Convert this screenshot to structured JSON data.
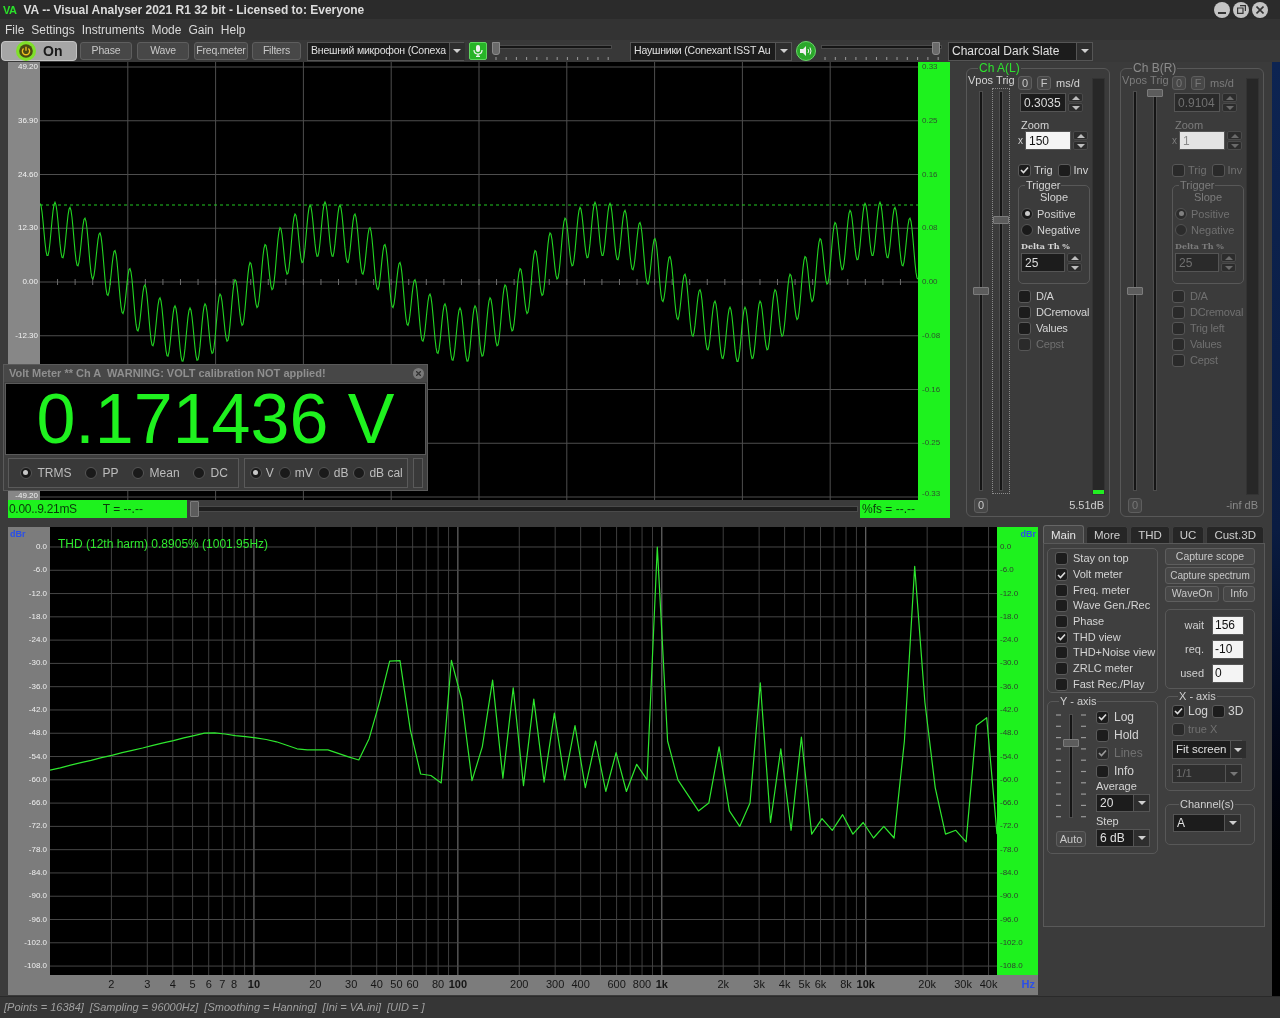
{
  "window": {
    "logo": "VA",
    "title": "VA -- Visual Analyser 2021 R1 32 bit - Licensed to: Everyone"
  },
  "menu": [
    "File",
    "Settings",
    "Instruments",
    "Mode",
    "Gain",
    "Help"
  ],
  "toolbar": {
    "power": {
      "label": "On",
      "on": true
    },
    "buttons": [
      "Phase",
      "Wave",
      "Freq.meter",
      "Filters"
    ],
    "input_device": "Внешний микрофон (Conexa",
    "input_volume": {
      "level": 0
    },
    "output_device": "Наушники (Conexant ISST Au",
    "output_volume": {
      "level": 0.98
    },
    "theme": "Charcoal Dark Slate"
  },
  "scope": {
    "left_axis": {
      "labels": [
        "49.20",
        "36.90",
        "24.60",
        "12.30",
        "0.00",
        "-12.30"
      ],
      "bottom_label": "-49.20"
    },
    "right_axis": [
      "0.33",
      "0.25",
      "0.16",
      "0.08",
      "0.00",
      "-0.08",
      "-0.16",
      "-0.25",
      "-0.33"
    ],
    "time_range": "0.00..9.21mS",
    "period": "T = --.--",
    "position": {
      "level": 0
    },
    "fs_reading": "%fs = --.--"
  },
  "volt_meter": {
    "title": "Volt Meter ** Ch A  WARNING: VOLT calibration NOT applied!",
    "reading": "0.171436 V",
    "modes": [
      {
        "label": "TRMS",
        "selected": true
      },
      {
        "label": "PP",
        "selected": false
      },
      {
        "label": "Mean",
        "selected": false
      },
      {
        "label": "DC",
        "selected": false
      }
    ],
    "units": [
      {
        "label": "V",
        "selected": true
      },
      {
        "label": "mV",
        "selected": false
      },
      {
        "label": "dB",
        "selected": false
      },
      {
        "label": "dB cal",
        "selected": false
      }
    ]
  },
  "channels": [
    {
      "title": "Ch A(L)",
      "disabled": false,
      "vpos_label": "Vpos",
      "trig_label": "Trig",
      "vpos": {
        "level": 0.5
      },
      "trig": {
        "level": 0.68,
        "focused": true
      },
      "zero_button": "0",
      "f_button": "F",
      "ms_label": "ms/d",
      "ms_value": "0.3035",
      "zoom_label": "Zoom",
      "zoom_x": "x",
      "zoom_value": "150",
      "trig_check": {
        "label": "Trig",
        "checked": true,
        "disabled": false
      },
      "inv_check": {
        "label": "Inv",
        "checked": false,
        "disabled": false
      },
      "trigger": {
        "title": "Trigger",
        "slope_label": "Slope",
        "slopes": [
          {
            "label": "Positive",
            "selected": true
          },
          {
            "label": "Negative",
            "selected": false
          }
        ],
        "delta_label": "Delta Th %",
        "delta_value": "25"
      },
      "options": [
        {
          "label": "D/A",
          "checked": false,
          "disabled": false
        },
        {
          "label": "DCremoval",
          "checked": false,
          "disabled": false
        },
        {
          "label": "Values",
          "checked": false,
          "disabled": false
        },
        {
          "label": "Cepst",
          "checked": false,
          "disabled": true
        }
      ],
      "reset_button": "0",
      "meter": {
        "level": 0.01
      },
      "meter_reading": "5.51dB"
    },
    {
      "title": "Ch B(R)",
      "disabled": true,
      "vpos_label": "Vpos",
      "trig_label": "Trig",
      "vpos": {
        "level": 0.5
      },
      "trig": {
        "level": 1,
        "focused": false
      },
      "zero_button": "0",
      "f_button": "F",
      "ms_label": "ms/d",
      "ms_value": "0.9104",
      "zoom_label": "Zoom",
      "zoom_x": "x",
      "zoom_value": "1",
      "trig_check": {
        "label": "Trig",
        "checked": false,
        "disabled": true
      },
      "inv_check": {
        "label": "Inv",
        "checked": false,
        "disabled": true
      },
      "trigger": {
        "title": "Trigger",
        "slope_label": "Slope",
        "slopes": [
          {
            "label": "Positive",
            "selected": true
          },
          {
            "label": "Negative",
            "selected": false
          }
        ],
        "delta_label": "Delta Th %",
        "delta_value": "25"
      },
      "options": [
        {
          "label": "D/A",
          "checked": false,
          "disabled": true
        },
        {
          "label": "DCremoval",
          "checked": false,
          "disabled": true
        },
        {
          "label": "Trig left",
          "checked": false,
          "disabled": true
        },
        {
          "label": "Values",
          "checked": false,
          "disabled": true
        },
        {
          "label": "Cepst",
          "checked": false,
          "disabled": true
        }
      ],
      "reset_button": "0",
      "meter_reading": "-inf dB"
    }
  ],
  "spectrum": {
    "readout": "THD (12th harm) 0.8905% (1001.95Hz)",
    "right_axis": {
      "unit": "dBr",
      "labels": [
        "0.0",
        "-6.0",
        "-12.0",
        "-18.0",
        "-24.0",
        "-30.0",
        "-36.0",
        "-42.0",
        "-48.0",
        "-54.0",
        "-60.0",
        "-66.0",
        "-72.0",
        "-78.0",
        "-84.0",
        "-90.0",
        "-96.0",
        "-102.0",
        "-108.0"
      ]
    },
    "x_axis": {
      "unit": "Hz",
      "decades": [
        {
          "m2": "2",
          "m3": "3",
          "m4": "4",
          "m5": "5",
          "m6": "6",
          "m7": "7",
          "m8": "8"
        },
        {
          "m1": "10",
          "m2": "20",
          "m3": "30",
          "m4": "40",
          "m5": "50",
          "m6": "60",
          "m8": "80"
        },
        {
          "m1": "100",
          "m2": "200",
          "m3": "300",
          "m4": "400",
          "m6": "600",
          "m8": "800"
        },
        {
          "m1": "1k",
          "m2": "2k",
          "m3": "3k",
          "m4": "4k",
          "m5": "5k",
          "m6": "6k",
          "m8": "8k"
        },
        {
          "m1": "10k",
          "m2": "20k",
          "m3": "30k",
          "m4": "40k"
        }
      ]
    },
    "chart_data": {
      "type": "line",
      "ylabel": "dBr",
      "grid": true,
      "ylim": [
        -110.3,
        5.15
      ],
      "categories": [
        null,
        null,
        null,
        null,
        null,
        null,
        null,
        null,
        null,
        null,
        null,
        null,
        null,
        null,
        null,
        null,
        null,
        null,
        null,
        null,
        null,
        null,
        null,
        null,
        null,
        null,
        null,
        null,
        null,
        null,
        null,
        null,
        null,
        null,
        null,
        null,
        null,
        null,
        null,
        null,
        null,
        null,
        null,
        null,
        null,
        null,
        null,
        null,
        null,
        null,
        null,
        null,
        null,
        null,
        null,
        null,
        null,
        null,
        null,
        null,
        null,
        null,
        null,
        null,
        null,
        null,
        null,
        null,
        null,
        null,
        null,
        null,
        null,
        null,
        null,
        null,
        null,
        null,
        null,
        null,
        null,
        null,
        null,
        null,
        null,
        null,
        null,
        null,
        null,
        null,
        null,
        null,
        null
      ],
      "values": [
        -57.5,
        -56.9,
        -56.2,
        -55.6,
        -55.0,
        -54.3,
        -53.7,
        -53.0,
        -52.4,
        -51.8,
        -51.1,
        -50.5,
        -49.9,
        -49.2,
        -48.6,
        -48.0,
        -47.9,
        -48.2,
        -48.6,
        -48.9,
        -49.2,
        -49.6,
        -50.2,
        -51.1,
        -52.0,
        -52.3,
        -52.3,
        -52.3,
        -53.2,
        -54.1,
        -54.9,
        -49.4,
        -40.1,
        -29.4,
        -29.3,
        -47.1,
        -58.5,
        -58.9,
        -60.8,
        -29.2,
        -39.3,
        -60.2,
        -51.5,
        -34.3,
        -59.6,
        -36.3,
        -61.5,
        -39.2,
        -60.6,
        -42.8,
        -60,
        -46,
        -62,
        -50,
        -63,
        -53,
        -63,
        -56,
        -60,
        0,
        -50,
        -60,
        -64,
        -68,
        -66,
        -51.5,
        -68,
        -72,
        -66,
        -35,
        -71,
        -52,
        -73,
        -49,
        -74,
        -70,
        -73,
        -69,
        -74,
        -71,
        -75,
        -72,
        -75,
        -50,
        -5,
        -40,
        -62,
        -74,
        -73,
        -76,
        -46,
        -44,
        -74
      ],
      "yticks": [
        {
          "value": 0,
          "label": "0.0"
        },
        {
          "value": -6,
          "label": "-6.0"
        },
        {
          "value": -12,
          "label": "-12.0"
        },
        {
          "value": -18,
          "label": "-18.0"
        },
        {
          "value": -24,
          "label": "-24.0"
        },
        {
          "value": -30,
          "label": "-30.0"
        },
        {
          "value": -36,
          "label": "-36.0"
        },
        {
          "value": -42,
          "label": "-42.0"
        },
        {
          "value": -48,
          "label": "-48.0"
        },
        {
          "value": -54,
          "label": "-54.0"
        },
        {
          "value": -60,
          "label": "-60.0"
        },
        {
          "value": -66,
          "label": "-66.0"
        },
        {
          "value": -72,
          "label": "-72.0"
        },
        {
          "value": -78,
          "label": "-78.0"
        },
        {
          "value": -84,
          "label": "-84.0"
        },
        {
          "value": -90,
          "label": "-90.0"
        },
        {
          "value": -96,
          "label": "-96.0"
        },
        {
          "value": -102,
          "label": "-102.0"
        },
        {
          "value": -108,
          "label": "-108.0"
        }
      ]
    }
  },
  "control_panel": {
    "tabs": [
      {
        "label": "Main",
        "selected": true
      },
      {
        "label": "More",
        "selected": false
      },
      {
        "label": "THD",
        "selected": false
      },
      {
        "label": "UC",
        "selected": false
      },
      {
        "label": "Cust.3D",
        "selected": false
      }
    ],
    "views": [
      {
        "label": "Stay on top",
        "checked": false
      },
      {
        "label": "Volt meter",
        "checked": true
      },
      {
        "label": "Freq. meter",
        "checked": false
      },
      {
        "label": "Wave Gen./Rec",
        "checked": false
      },
      {
        "label": "Phase",
        "checked": false
      },
      {
        "label": "THD view",
        "checked": true
      },
      {
        "label": "THD+Noise view",
        "checked": false
      },
      {
        "label": "ZRLC meter",
        "checked": false
      },
      {
        "label": "Fast Rec./Play",
        "checked": false
      }
    ],
    "actions": [
      "Capture scope",
      "Capture spectrum",
      "WaveOn",
      "Info"
    ],
    "timing": [
      {
        "label": "wait",
        "value": "156"
      },
      {
        "label": "req.",
        "value": "-10"
      },
      {
        "label": "used",
        "value": "0"
      }
    ],
    "y_axis": {
      "title": "Y - axis",
      "slider": {
        "level": 0.73
      },
      "options": [
        {
          "label": "Log",
          "checked": true,
          "disabled": false
        },
        {
          "label": "Hold",
          "checked": false,
          "disabled": false
        },
        {
          "label": "Lines",
          "checked": true,
          "disabled": true
        },
        {
          "label": "Info",
          "checked": false,
          "disabled": false
        }
      ],
      "average_label": "Average",
      "average": "20",
      "step_label": "Step",
      "step": "6 dB",
      "auto_button": "Auto"
    },
    "x_axis": {
      "title": "X - axis",
      "options": [
        {
          "label": "Log",
          "checked": true,
          "disabled": false
        },
        {
          "label": "3D",
          "checked": false,
          "disabled": false
        },
        {
          "label": "true X",
          "checked": false,
          "disabled": true
        }
      ],
      "scale": {
        "value": "Fit screen",
        "disabled": false
      },
      "fraction": {
        "value": "1/1",
        "disabled": true
      }
    },
    "channel_select": {
      "title": "Channel(s)",
      "value": "A"
    }
  },
  "status_bar": [
    "[Points = 16384]",
    "[Sampling = 96000Hz]",
    "[Smoothing = Hanning]",
    "[Ini = VA.ini]",
    "[UID = ]"
  ]
}
